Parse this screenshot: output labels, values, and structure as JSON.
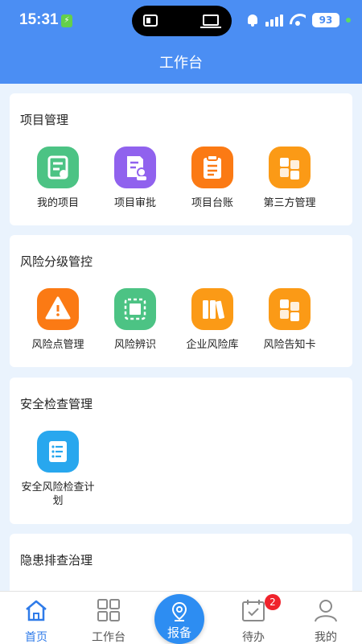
{
  "status_bar": {
    "time": "15:31",
    "battery": "93"
  },
  "header": {
    "title": "工作台"
  },
  "sections": [
    {
      "title": "项目管理",
      "items": [
        {
          "label": "我的项目",
          "icon": "project-doc-icon",
          "color": "#4cc384"
        },
        {
          "label": "项目审批",
          "icon": "approval-doc-icon",
          "color": "#9062ee"
        },
        {
          "label": "项目台账",
          "icon": "clipboard-icon",
          "color": "#fb7a14"
        },
        {
          "label": "第三方管理",
          "icon": "blocks-icon",
          "color": "#fb9a16"
        }
      ]
    },
    {
      "title": "风险分级管控",
      "items": [
        {
          "label": "风险点管理",
          "icon": "warning-icon",
          "color": "#fb7a14"
        },
        {
          "label": "风险辨识",
          "icon": "scan-frame-icon",
          "color": "#4cc384"
        },
        {
          "label": "企业风险库",
          "icon": "books-icon",
          "color": "#fb9a16"
        },
        {
          "label": "风险告知卡",
          "icon": "blocks-icon",
          "color": "#fb9a16"
        }
      ]
    },
    {
      "title": "安全检查管理",
      "items": [
        {
          "label": "安全风险检查计划",
          "icon": "checklist-icon",
          "color": "#28a7ee"
        }
      ]
    },
    {
      "title": "隐患排查治理",
      "items": []
    }
  ],
  "tabbar": {
    "tabs": [
      {
        "label": "首页",
        "icon": "home-icon",
        "active": true
      },
      {
        "label": "工作台",
        "icon": "grid-icon",
        "active": false
      },
      {
        "label": "待办",
        "icon": "calendar-check-icon",
        "active": false,
        "badge": "2"
      },
      {
        "label": "我的",
        "icon": "user-icon",
        "active": false
      }
    ],
    "center": {
      "label": "报备",
      "icon": "location-pin-icon"
    }
  },
  "colors": {
    "primary": "#4b8ef3",
    "tab_active": "#2f7be9",
    "badge": "#f0232c"
  }
}
